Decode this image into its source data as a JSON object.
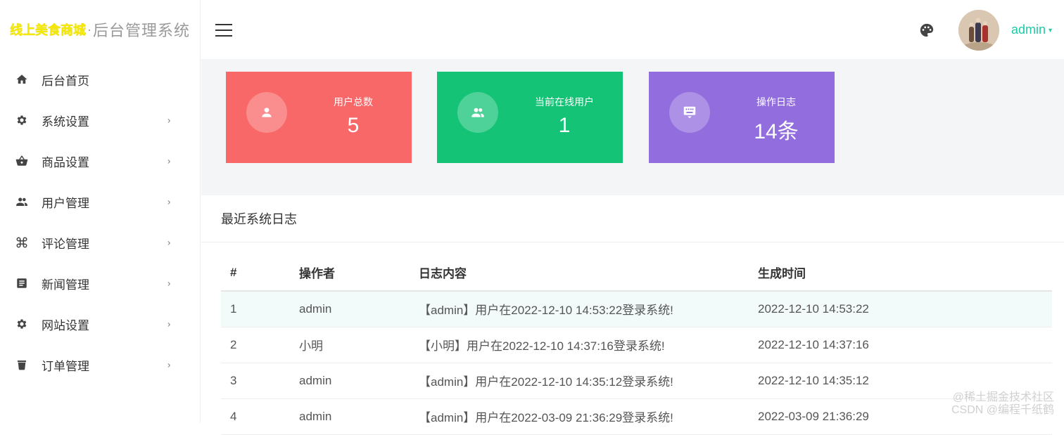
{
  "brand": {
    "logo": "线上美食商城",
    "separator": "·",
    "system": "后台管理系统"
  },
  "sidebar": {
    "items": [
      {
        "label": "后台首页",
        "icon": "home-icon",
        "has_arrow": false
      },
      {
        "label": "系统设置",
        "icon": "gear-icon",
        "has_arrow": true
      },
      {
        "label": "商品设置",
        "icon": "basket-icon",
        "has_arrow": true
      },
      {
        "label": "用户管理",
        "icon": "users-icon",
        "has_arrow": true
      },
      {
        "label": "评论管理",
        "icon": "command-icon",
        "has_arrow": true
      },
      {
        "label": "新闻管理",
        "icon": "article-icon",
        "has_arrow": true
      },
      {
        "label": "网站设置",
        "icon": "gear-icon",
        "has_arrow": true
      },
      {
        "label": "订单管理",
        "icon": "trash-icon",
        "has_arrow": true
      }
    ],
    "arrow": "›"
  },
  "topbar": {
    "user": "admin",
    "caret": "▾"
  },
  "stats": [
    {
      "title": "用户总数",
      "value": "5",
      "color": "#f96868"
    },
    {
      "title": "当前在线用户",
      "value": "1",
      "color": "#15c377"
    },
    {
      "title": "操作日志",
      "value": "14条",
      "color": "#926dde"
    }
  ],
  "logs": {
    "title": "最近系统日志",
    "columns": [
      "#",
      "操作者",
      "日志内容",
      "生成时间"
    ],
    "rows": [
      {
        "id": "1",
        "operator": "admin",
        "content": "【admin】用户在2022-12-10 14:53:22登录系统!",
        "time": "2022-12-10 14:53:22"
      },
      {
        "id": "2",
        "operator": "小明",
        "content": "【小明】用户在2022-12-10 14:37:16登录系统!",
        "time": "2022-12-10 14:37:16"
      },
      {
        "id": "3",
        "operator": "admin",
        "content": "【admin】用户在2022-12-10 14:35:12登录系统!",
        "time": "2022-12-10 14:35:12"
      },
      {
        "id": "4",
        "operator": "admin",
        "content": "【admin】用户在2022-03-09 21:36:29登录系统!",
        "time": "2022-03-09 21:36:29"
      }
    ]
  },
  "watermark": {
    "line1": "@稀土掘金技术社区",
    "line2": "CSDN @编程千纸鹤"
  }
}
